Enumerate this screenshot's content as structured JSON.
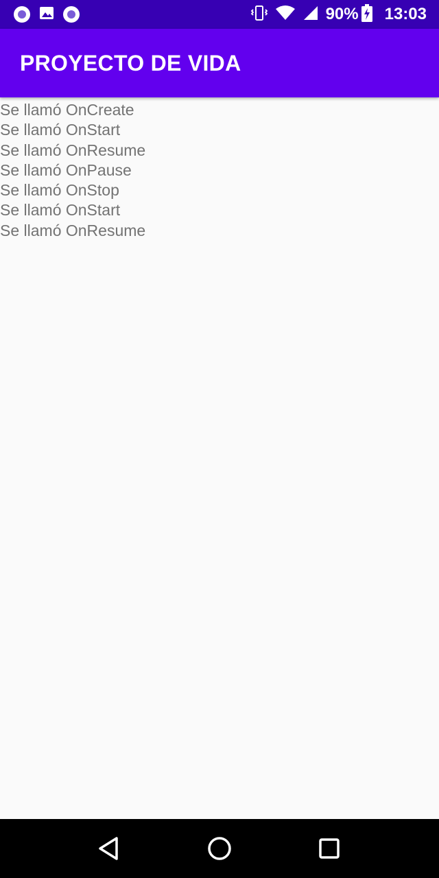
{
  "status_bar": {
    "battery_percent": "90%",
    "time": "13:03",
    "icons": [
      "notification-circle-icon",
      "gallery-icon",
      "notification-circle-icon",
      "vibrate-icon",
      "wifi-icon",
      "signal-icon",
      "battery-charging-icon"
    ]
  },
  "app_bar": {
    "title": "PROYECTO DE VIDA",
    "color": "#6200ee"
  },
  "log": {
    "lines": [
      "Se llamó OnCreate",
      "Se llamó OnStart",
      "Se llamó OnResume",
      "Se llamó OnPause",
      "Se llamó OnStop",
      "Se llamó OnStart",
      "Se llamó OnResume"
    ]
  },
  "nav_bar": {
    "icons": [
      "back-icon",
      "home-icon",
      "recents-icon"
    ]
  }
}
